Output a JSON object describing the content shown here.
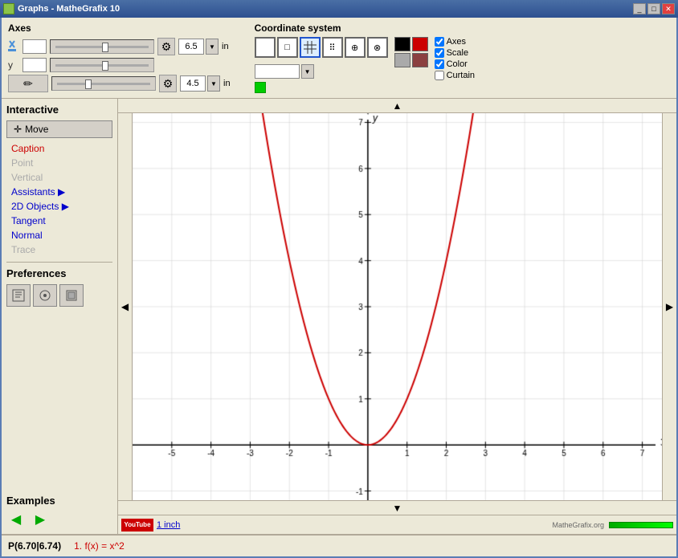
{
  "title": "Graphs - MatheGrafix 10",
  "axes": {
    "label": "Axes",
    "x_value": "",
    "y_value": "y",
    "width_value": "6.5",
    "height_value": "4.5",
    "unit": "in"
  },
  "coordinate_system": {
    "label": "Coordinate system",
    "checkboxes": [
      {
        "label": "Axes",
        "checked": true
      },
      {
        "label": "Scale",
        "checked": true
      },
      {
        "label": "Color",
        "checked": true
      },
      {
        "label": "Curtain",
        "checked": false
      }
    ]
  },
  "interactive": {
    "label": "Interactive",
    "move_btn": "Move",
    "items": [
      {
        "label": "Caption",
        "state": "active"
      },
      {
        "label": "Point",
        "state": "disabled"
      },
      {
        "label": "Vertical",
        "state": "disabled"
      },
      {
        "label": "Assistants ▶",
        "state": "blue"
      },
      {
        "label": "2D Objects ▶",
        "state": "blue"
      },
      {
        "label": "Tangent",
        "state": "blue"
      },
      {
        "label": "Normal",
        "state": "blue"
      },
      {
        "label": "Trace",
        "state": "disabled"
      }
    ]
  },
  "preferences": {
    "label": "Preferences"
  },
  "examples": {
    "label": "Examples",
    "prev": "◀",
    "next": "▶"
  },
  "graph": {
    "x_axis_label": "x",
    "y_axis_label": "y",
    "x_min": -6,
    "x_max": 7,
    "y_min": -1,
    "y_max": 7,
    "function": "x^2"
  },
  "status": {
    "coords": "P(6.70|6.74)",
    "formula_index": "1.",
    "formula": "f(x) = x^2"
  },
  "bottom": {
    "youtube_label": "YouTube",
    "inch_label": "1 inch",
    "logo": "MatheGrafix.org"
  }
}
